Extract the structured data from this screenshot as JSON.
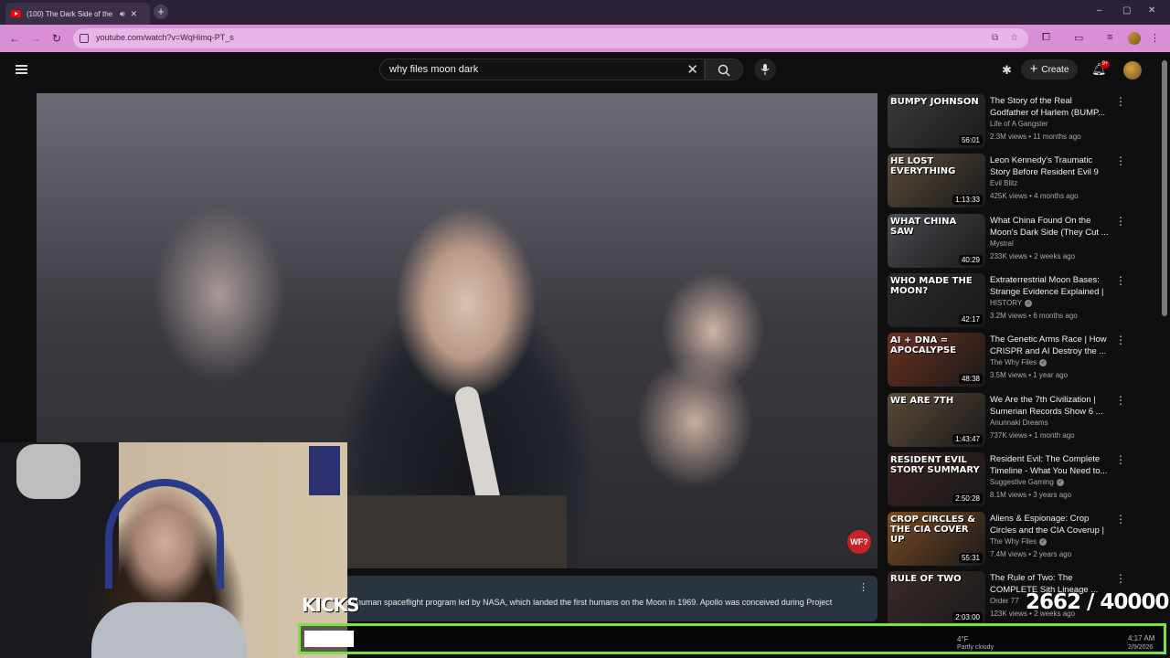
{
  "browser": {
    "tab_title": "(100) The Dark Side of the M",
    "new_tab": "+",
    "window_controls": [
      "–",
      "▢",
      "✕"
    ],
    "url": "youtube.com/watch?v=WqHimq-PT_s"
  },
  "header": {
    "search_query": "why files moon dark",
    "create_label": "Create",
    "notification_count": "9+"
  },
  "video": {
    "channel_badge": "WF?",
    "description": "es human spaceflight program led by NASA, which landed the first humans on the Moon in 1969. Apollo was conceived during Project"
  },
  "overlay": {
    "kicks_label": "KICKS",
    "counter": "2662  / 40000"
  },
  "taskbar": {
    "weather": "4°F",
    "weather_desc": "Partly cloudy",
    "time": "4:17 AM",
    "date": "2/9/2026"
  },
  "sidebar": {
    "items": [
      {
        "title": "The Story of the Real Godfather of Harlem (BUMP...",
        "channel": "Life of A Gangster",
        "meta": "2.3M views • 11 months ago",
        "duration": "56:01",
        "thumb_text": "BUMPY JOHNSON",
        "thumb_color": "#3a3a3a",
        "verified": false
      },
      {
        "title": "Leon Kennedy's Traumatic Story Before Resident Evil 9",
        "channel": "Evil Blitz",
        "meta": "425K views • 4 months ago",
        "duration": "1:13:33",
        "thumb_text": "HE LOST EVERYTHING",
        "thumb_color": "#5a4a3a",
        "verified": false
      },
      {
        "title": "What China Found On the Moon's Dark Side (They Cut ...",
        "channel": "Mystral",
        "meta": "233K views • 2 weeks ago",
        "duration": "40:29",
        "thumb_text": "WHAT CHINA SAW",
        "thumb_color": "#4a4a50",
        "verified": false
      },
      {
        "title": "Extraterrestrial Moon Bases: Strange Evidence Explained | ...",
        "channel": "HISTORY",
        "meta": "3.2M views • 6 months ago",
        "duration": "42:17",
        "thumb_text": "WHO MADE THE MOON?",
        "thumb_color": "#2a2a2e",
        "verified": true
      },
      {
        "title": "The Genetic Arms Race | How CRISPR and AI Destroy the ...",
        "channel": "The Why Files",
        "meta": "3.5M views • 1 year ago",
        "duration": "48:38",
        "thumb_text": "AI + DNA = APOCALYPSE",
        "thumb_color": "#6a3020",
        "verified": true
      },
      {
        "title": "We Are the 7th Civilization | Sumerian Records Show 6 ...",
        "channel": "Anunnaki Dreams",
        "meta": "737K views • 1 month ago",
        "duration": "1:43:47",
        "thumb_text": "WE ARE 7TH",
        "thumb_color": "#5a4a38",
        "verified": false
      },
      {
        "title": "Resident Evil: The Complete Timeline - What You Need to...",
        "channel": "Suggestive Gaming",
        "meta": "8.1M views • 3 years ago",
        "duration": "2:50:28",
        "thumb_text": "RESIDENT EVIL STORY SUMMARY",
        "thumb_color": "#3a2020",
        "verified": true
      },
      {
        "title": "Aliens & Espionage: Crop Circles and the CIA Coverup | ...",
        "channel": "The Why Files",
        "meta": "7.4M views • 2 years ago",
        "duration": "55:31",
        "thumb_text": "CROP CIRCLES & THE CIA COVER UP",
        "thumb_color": "#7a4a20",
        "verified": true
      },
      {
        "title": "The Rule of Two: The COMPLETE Sith Lineage ...",
        "channel": "Order 77",
        "meta": "123K views • 2 weeks ago",
        "duration": "2:03:00",
        "thumb_text": "RULE OF TWO",
        "thumb_color": "#3a2a28",
        "verified": false
      }
    ]
  }
}
